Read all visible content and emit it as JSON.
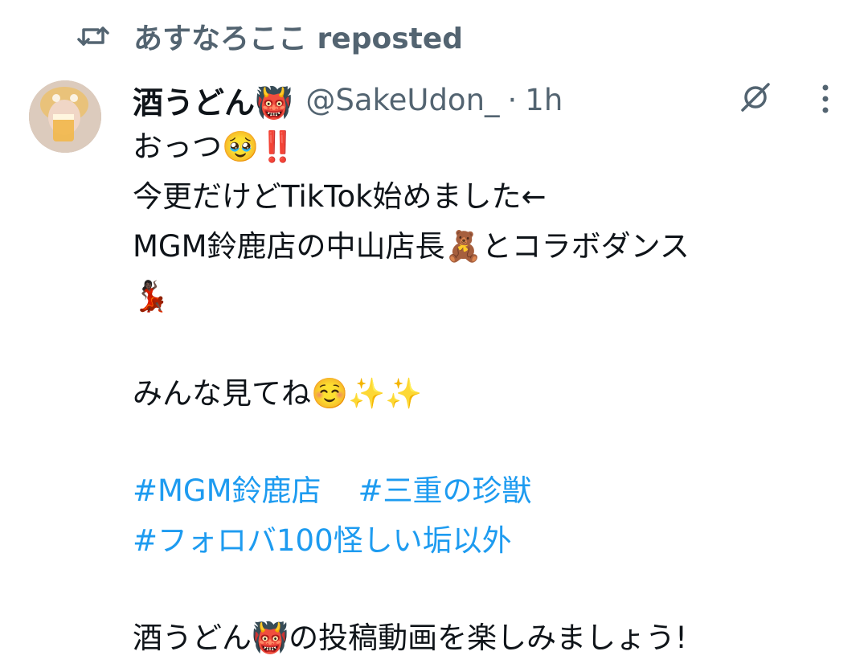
{
  "repost": {
    "icon": "repost-icon",
    "text": "あすなろここ reposted"
  },
  "author": {
    "display_name": "酒うどん👹",
    "handle": "@SakeUdon_",
    "separator": "·",
    "time": "1h"
  },
  "actions": {
    "grok_icon": "grok-icon",
    "more_icon": "more-vertical-icon"
  },
  "tweet": {
    "line1": "おっつ🥹‼️",
    "line2": "今更だけどTikTok始めました←",
    "line3": "MGM鈴鹿店の中山店長🧸とコラボダンス",
    "line4": "💃🏿",
    "line5": "みんな見てね☺️✨✨",
    "hashtags_line1": [
      "#MGM鈴鹿店",
      "#三重の珍獣"
    ],
    "hashtags_line2": [
      "#フォロバ100怪しい垢以外"
    ],
    "line6": "酒うどん👹の投稿動画を楽しみましょう!"
  },
  "colors": {
    "text_primary": "#0f1419",
    "text_secondary": "#536471",
    "link": "#1d9bf0",
    "background": "#ffffff"
  }
}
